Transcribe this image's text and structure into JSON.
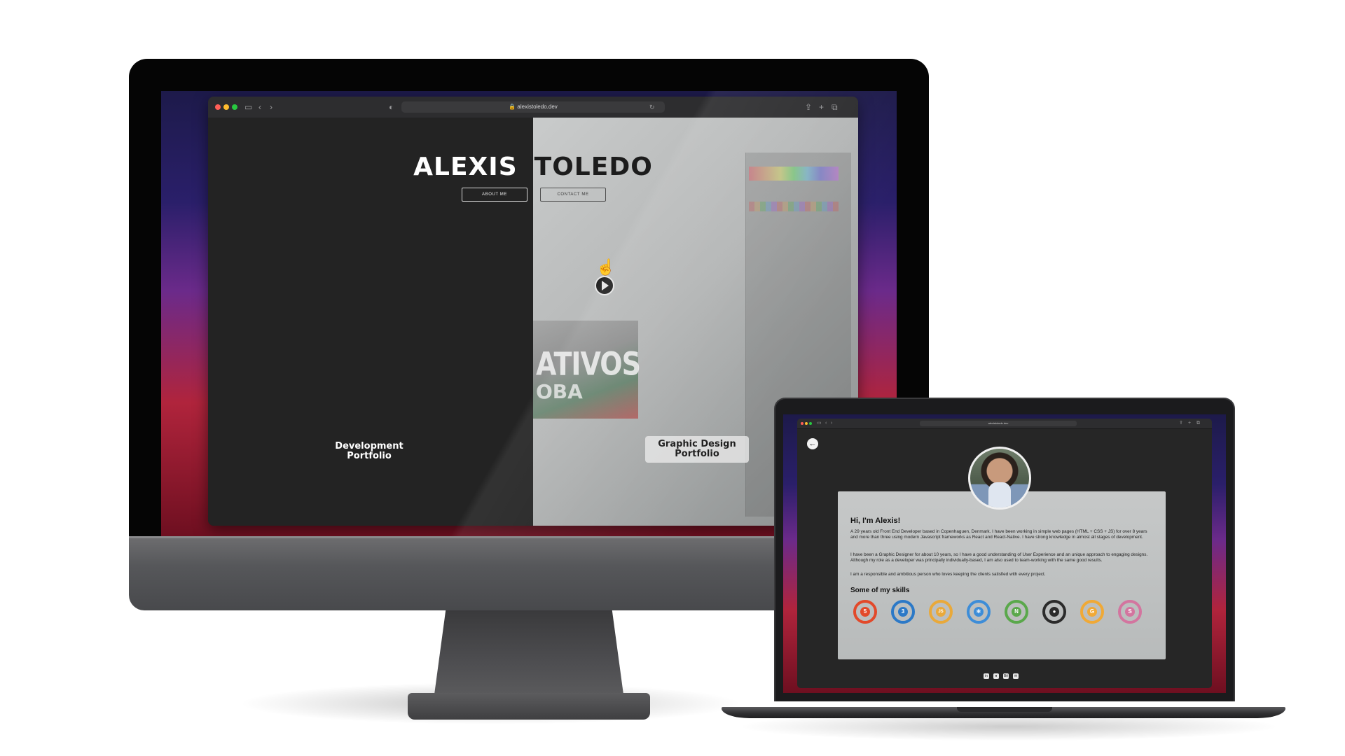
{
  "imac": {
    "url": "alexistoledo.dev",
    "hero": {
      "first_name": "ALEXIS",
      "last_name": "TOLEDO",
      "about_button": "ABOUT ME",
      "contact_button": "CONTACT ME"
    },
    "left_panel_label": "Development Portfolio",
    "right_panel_label": "Graphic Design Portfolio",
    "poster_text_1": "ATIVOS",
    "poster_text_2": "OBA"
  },
  "macbook": {
    "url": "alexistoledo.dev",
    "about": {
      "greeting": "Hi, I'm Alexis!",
      "paragraphs": [
        "A 29 years old Front End Developer based in Copenhaguen, Denmark. I have been working in simple web pages (HTML + CSS + JS) for over 8 years and more than three using modern Javascript frameworks as React and React-Native. I have strong knowledge in almost all stages of development.",
        "I have been a Graphic Designer for about 10 years, so I have a good understanding of User Experience and an unique approach to engaging designs. Although my role as a developer was principally individually-based, I am also used to team-working with the same good results.",
        "I am a responsible and ambitious person who loves keeping the clients satisfied with every project."
      ],
      "skills_heading": "Some of my skills",
      "skills": [
        {
          "icon": "html5-icon",
          "color": "#e2492a",
          "glyph": "5"
        },
        {
          "icon": "css3-icon",
          "color": "#2c79c7",
          "glyph": "3"
        },
        {
          "icon": "javascript-icon",
          "color": "#e9a93a",
          "glyph": "JS"
        },
        {
          "icon": "react-icon",
          "color": "#3d8dd8",
          "glyph": "⚛"
        },
        {
          "icon": "node-icon",
          "color": "#5aa84b",
          "glyph": "N"
        },
        {
          "icon": "github-icon",
          "color": "#2b2b2b",
          "glyph": "●"
        },
        {
          "icon": "gatsby-icon",
          "color": "#f0a936",
          "glyph": "G"
        },
        {
          "icon": "sass-icon",
          "color": "#d3759f",
          "glyph": "S"
        }
      ]
    },
    "footer_icons": [
      "linkedin-icon",
      "github-icon",
      "behance-icon",
      "mail-icon"
    ]
  },
  "colors": {
    "accent_red": "#b0243c",
    "dark_bg": "#232323"
  }
}
